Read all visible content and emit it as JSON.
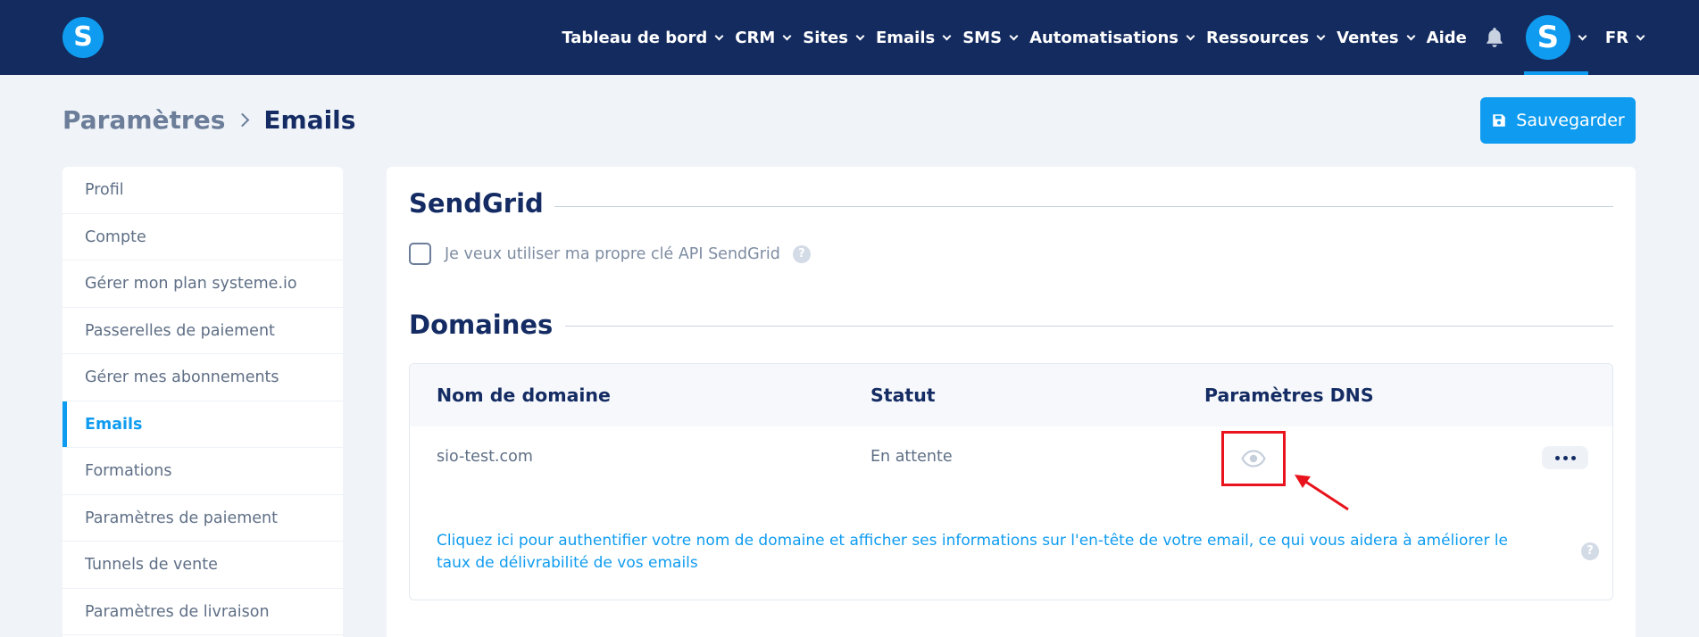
{
  "nav": {
    "logo_letter": "S",
    "items": [
      {
        "label": "Tableau de bord",
        "dropdown": true
      },
      {
        "label": "CRM",
        "dropdown": true
      },
      {
        "label": "Sites",
        "dropdown": true
      },
      {
        "label": "Emails",
        "dropdown": true
      },
      {
        "label": "SMS",
        "dropdown": true
      },
      {
        "label": "Automatisations",
        "dropdown": true
      },
      {
        "label": "Ressources",
        "dropdown": true
      },
      {
        "label": "Ventes",
        "dropdown": true
      },
      {
        "label": "Aide",
        "dropdown": false
      }
    ],
    "avatar_letter": "S",
    "language": "FR"
  },
  "header": {
    "breadcrumb_parent": "Paramètres",
    "breadcrumb_current": "Emails",
    "save_label": "Sauvegarder"
  },
  "sidebar": {
    "items": [
      {
        "label": "Profil",
        "active": false
      },
      {
        "label": "Compte",
        "active": false
      },
      {
        "label": "Gérer mon plan systeme.io",
        "active": false
      },
      {
        "label": "Passerelles de paiement",
        "active": false
      },
      {
        "label": "Gérer mes abonnements",
        "active": false
      },
      {
        "label": "Emails",
        "active": true
      },
      {
        "label": "Formations",
        "active": false
      },
      {
        "label": "Paramètres de paiement",
        "active": false
      },
      {
        "label": "Tunnels de vente",
        "active": false
      },
      {
        "label": "Paramètres de livraison",
        "active": false
      }
    ]
  },
  "sendgrid": {
    "title": "SendGrid",
    "checkbox_label": "Je veux utiliser ma propre clé API SendGrid",
    "help_symbol": "?"
  },
  "domains": {
    "title": "Domaines",
    "columns": [
      "Nom de domaine",
      "Statut",
      "Paramètres DNS"
    ],
    "rows": [
      {
        "domain": "sio-test.com",
        "status": "En attente"
      }
    ],
    "info_text": "Cliquez ici pour authentifier votre nom de domaine et afficher ses informations sur l'en-tête de votre email, ce qui vous aidera à améliorer le taux de délivrabilité de vos emails",
    "help_symbol": "?"
  },
  "colors": {
    "topbar": "#142b5f",
    "accent": "#0f9cf0",
    "highlight": "#e8131c"
  }
}
